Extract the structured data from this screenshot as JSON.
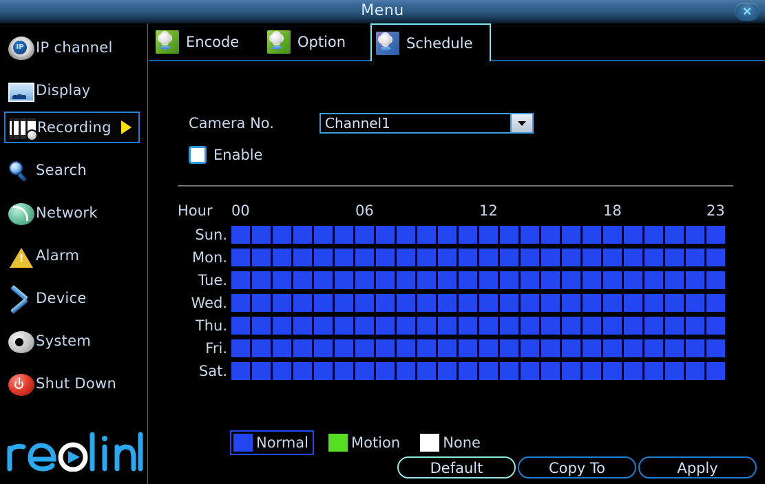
{
  "window": {
    "title": "Menu",
    "close_icon": "close-icon",
    "close_glyph": "×"
  },
  "sidebar": {
    "items": [
      {
        "label": "IP channel",
        "icon": "ip-camera-icon",
        "selected": false
      },
      {
        "label": "Display",
        "icon": "monitor-icon",
        "selected": false
      },
      {
        "label": "Recording",
        "icon": "film-reel-gear-icon",
        "selected": true,
        "arrow": "chevron-right-icon"
      },
      {
        "label": "Search",
        "icon": "magnifier-icon",
        "selected": false
      },
      {
        "label": "Network",
        "icon": "wifi-signal-icon",
        "selected": false
      },
      {
        "label": "Alarm",
        "icon": "warning-triangle-icon",
        "selected": false
      },
      {
        "label": "Device",
        "icon": "tools-icon",
        "selected": false
      },
      {
        "label": "System",
        "icon": "gear-icon",
        "selected": false
      },
      {
        "label": "Shut Down",
        "icon": "power-icon",
        "selected": false
      }
    ],
    "brand": "reolink"
  },
  "tabs": [
    {
      "label": "Encode",
      "icon": "gear-arrow-green-icon",
      "active": false
    },
    {
      "label": "Option",
      "icon": "gear-arrow-green-icon",
      "active": false
    },
    {
      "label": "Schedule",
      "icon": "gear-arrow-blue-icon",
      "active": true
    }
  ],
  "form": {
    "camera_label": "Camera No.",
    "camera_value": "Channel1",
    "camera_options": [
      "Channel1"
    ],
    "enable_label": "Enable",
    "enable_checked": false
  },
  "schedule": {
    "hour_label": "Hour",
    "hour_ticks": [
      {
        "text": "00",
        "hour": 0
      },
      {
        "text": "06",
        "hour": 6
      },
      {
        "text": "12",
        "hour": 12
      },
      {
        "text": "18",
        "hour": 18
      },
      {
        "text": "23",
        "hour": 23
      }
    ],
    "days": [
      "Sun.",
      "Mon.",
      "Tue.",
      "Wed.",
      "Thu.",
      "Fri.",
      "Sat."
    ],
    "hours_per_day": 24,
    "cells": [
      [
        "normal",
        "normal",
        "normal",
        "normal",
        "normal",
        "normal",
        "normal",
        "normal",
        "normal",
        "normal",
        "normal",
        "normal",
        "normal",
        "normal",
        "normal",
        "normal",
        "normal",
        "normal",
        "normal",
        "normal",
        "normal",
        "normal",
        "normal",
        "normal"
      ],
      [
        "normal",
        "normal",
        "normal",
        "normal",
        "normal",
        "normal",
        "normal",
        "normal",
        "normal",
        "normal",
        "normal",
        "normal",
        "normal",
        "normal",
        "normal",
        "normal",
        "normal",
        "normal",
        "normal",
        "normal",
        "normal",
        "normal",
        "normal",
        "normal"
      ],
      [
        "normal",
        "normal",
        "normal",
        "normal",
        "normal",
        "normal",
        "normal",
        "normal",
        "normal",
        "normal",
        "normal",
        "normal",
        "normal",
        "normal",
        "normal",
        "normal",
        "normal",
        "normal",
        "normal",
        "normal",
        "normal",
        "normal",
        "normal",
        "normal"
      ],
      [
        "normal",
        "normal",
        "normal",
        "normal",
        "normal",
        "normal",
        "normal",
        "normal",
        "normal",
        "normal",
        "normal",
        "normal",
        "normal",
        "normal",
        "normal",
        "normal",
        "normal",
        "normal",
        "normal",
        "normal",
        "normal",
        "normal",
        "normal",
        "normal"
      ],
      [
        "normal",
        "normal",
        "normal",
        "normal",
        "normal",
        "normal",
        "normal",
        "normal",
        "normal",
        "normal",
        "normal",
        "normal",
        "normal",
        "normal",
        "normal",
        "normal",
        "normal",
        "normal",
        "normal",
        "normal",
        "normal",
        "normal",
        "normal",
        "normal"
      ],
      [
        "normal",
        "normal",
        "normal",
        "normal",
        "normal",
        "normal",
        "normal",
        "normal",
        "normal",
        "normal",
        "normal",
        "normal",
        "normal",
        "normal",
        "normal",
        "normal",
        "normal",
        "normal",
        "normal",
        "normal",
        "normal",
        "normal",
        "normal",
        "normal"
      ],
      [
        "normal",
        "normal",
        "normal",
        "normal",
        "normal",
        "normal",
        "normal",
        "normal",
        "normal",
        "normal",
        "normal",
        "normal",
        "normal",
        "normal",
        "normal",
        "normal",
        "normal",
        "normal",
        "normal",
        "normal",
        "normal",
        "normal",
        "normal",
        "normal"
      ]
    ]
  },
  "legend": [
    {
      "label": "Normal",
      "key": "normal",
      "color": "#2346f0",
      "selected": true
    },
    {
      "label": "Motion",
      "key": "motion",
      "color": "#55dd22",
      "selected": false
    },
    {
      "label": "None",
      "key": "none",
      "color": "#ffffff",
      "selected": false
    }
  ],
  "buttons": [
    {
      "label": "Default",
      "focused": true
    },
    {
      "label": "Copy To",
      "focused": false
    },
    {
      "label": "Apply",
      "focused": false
    }
  ],
  "colors": {
    "accent_blue": "#1b7fd0",
    "focus_cyan": "#8fe8e0",
    "normal_cell": "#2346f0",
    "motion_cell": "#55dd22",
    "none_cell": "#ffffff",
    "brand_blue": "#2aa8f0",
    "arrow_yellow": "#ffe000"
  }
}
